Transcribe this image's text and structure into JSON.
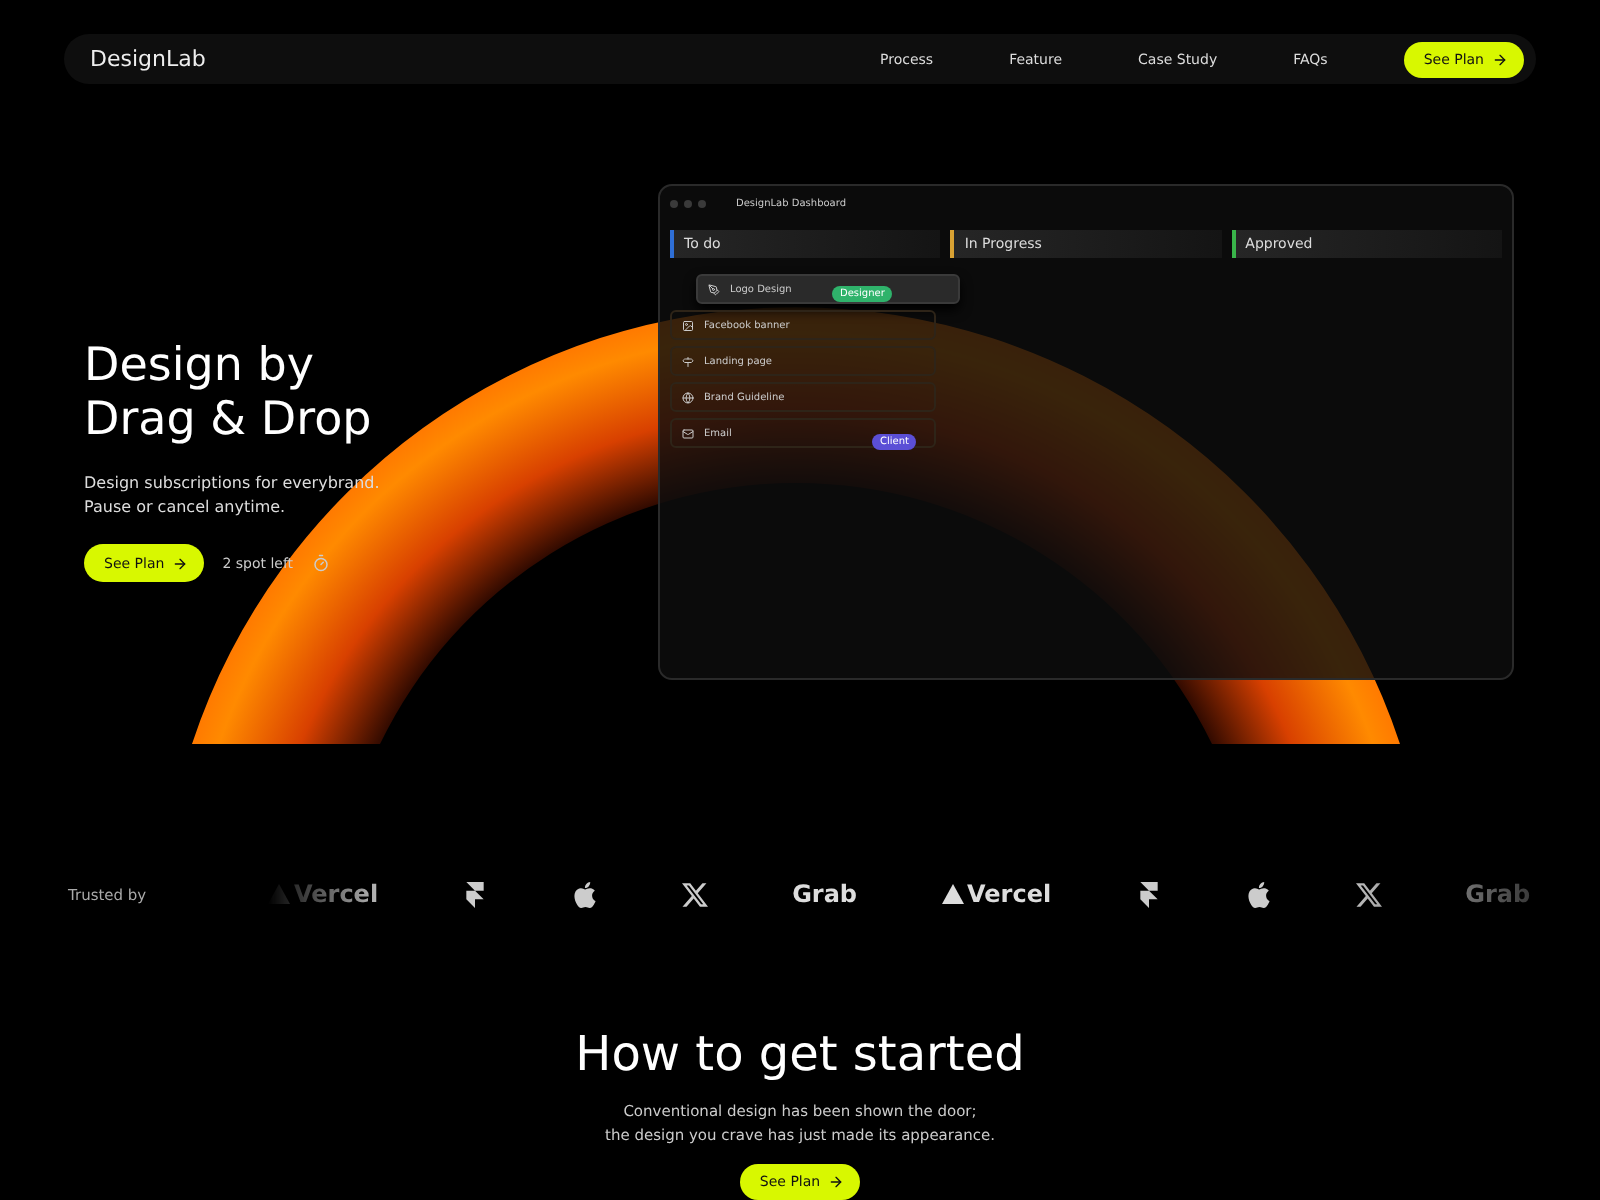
{
  "nav": {
    "brand": "DesignLab",
    "links": [
      "Process",
      "Feature",
      "Case Study",
      "FAQs"
    ],
    "cta": "See Plan"
  },
  "hero": {
    "title_lines": [
      "Design by",
      "Drag & Drop"
    ],
    "subtitle_lines": [
      "Design subscriptions for everybrand.",
      "Pause or cancel anytime."
    ],
    "cta": "See Plan",
    "note": "2 spot left"
  },
  "dashboard": {
    "title": "DesignLab Dashboard",
    "columns": [
      {
        "name": "To do",
        "color": "#2f6fd6"
      },
      {
        "name": "In Progress",
        "color": "#d9a233"
      },
      {
        "name": "Approved",
        "color": "#39b54a"
      }
    ],
    "cards": [
      {
        "label": "Logo Design",
        "kind": "pen",
        "dragging": true
      },
      {
        "label": "Facebook banner",
        "kind": "image",
        "dragging": false
      },
      {
        "label": "Landing page",
        "kind": "sign",
        "dragging": false
      },
      {
        "label": "Brand Guideline",
        "kind": "globe",
        "dragging": false
      },
      {
        "label": "Email",
        "kind": "mail",
        "dragging": false
      }
    ],
    "cursors": [
      {
        "name": "Designer",
        "color": "#2fb36b"
      },
      {
        "name": "Client",
        "color": "#5b4fd6"
      }
    ]
  },
  "trusted": {
    "label": "Trusted by",
    "logos": [
      {
        "kind": "vercel",
        "text": "Vercel"
      },
      {
        "kind": "framer"
      },
      {
        "kind": "apple"
      },
      {
        "kind": "x"
      },
      {
        "kind": "grab",
        "text": "Grab"
      },
      {
        "kind": "vercel",
        "text": "Vercel"
      },
      {
        "kind": "framer"
      },
      {
        "kind": "apple"
      },
      {
        "kind": "x"
      },
      {
        "kind": "grab",
        "text": "Grab"
      }
    ]
  },
  "section": {
    "title": "How to get started",
    "text_lines": [
      "Conventional design has been shown the door;",
      "the design you crave has just made its appearance."
    ],
    "cta": "See Plan"
  }
}
